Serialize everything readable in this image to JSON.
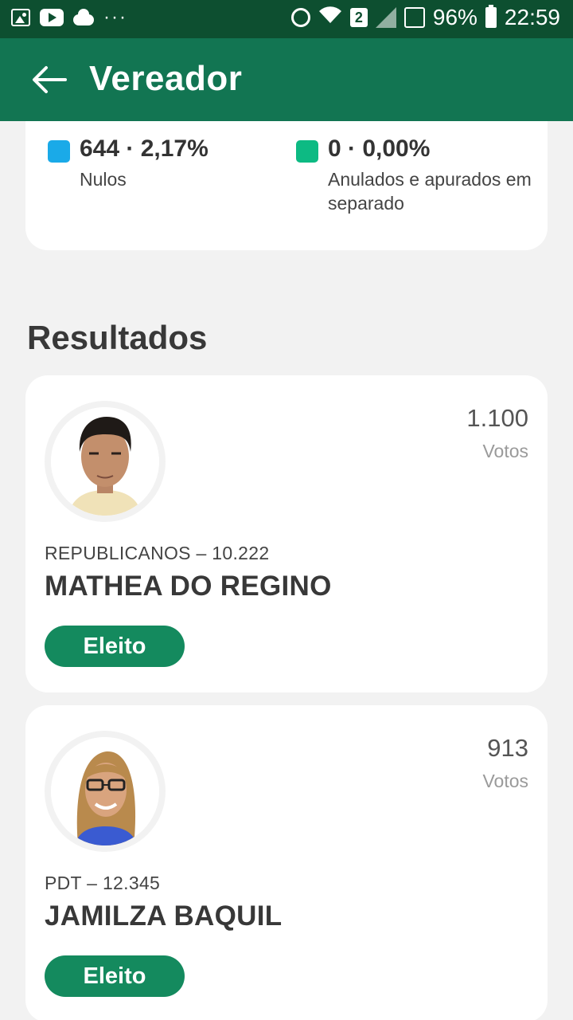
{
  "status_bar": {
    "battery": "96%",
    "time": "22:59",
    "sim_slot": "2",
    "dots": "···"
  },
  "header": {
    "title": "Vereador"
  },
  "summary": {
    "items": [
      {
        "value": "644 · 2,17%",
        "label": "Nulos",
        "color": "#1aaae8"
      },
      {
        "value": "0 · 0,00%",
        "label": "Anulados e apurados em separado",
        "color": "#0dba83"
      }
    ]
  },
  "results": {
    "title": "Resultados",
    "candidates": [
      {
        "votes": "1.100",
        "votes_label": "Votos",
        "party": "REPUBLICANOS – 10.222",
        "name": "MATHEA DO REGINO",
        "status": "Eleito"
      },
      {
        "votes": "913",
        "votes_label": "Votos",
        "party": "PDT – 12.345",
        "name": "JAMILZA BAQUIL",
        "status": "Eleito"
      }
    ]
  },
  "colors": {
    "status_bar": "#0d4f30",
    "app_bar": "#127552",
    "badge": "#148a5e"
  }
}
